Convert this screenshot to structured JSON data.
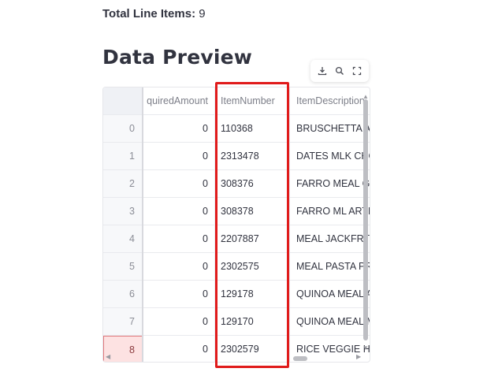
{
  "summary": {
    "label": "Total Line Items:",
    "value": "9"
  },
  "section": {
    "title": "Data Preview"
  },
  "toolbar": {
    "download_icon": "download-icon",
    "search_icon": "search-icon",
    "fullscreen_icon": "fullscreen-icon"
  },
  "table": {
    "columns": {
      "req": "quiredAmount",
      "item": "ItemNumber",
      "desc": "ItemDescription"
    },
    "rows": [
      {
        "idx": "0",
        "req": "0",
        "item": "110368",
        "desc": "BRUSCHETTA A"
      },
      {
        "idx": "1",
        "req": "0",
        "item": "2313478",
        "desc": "DATES MLK CHO"
      },
      {
        "idx": "2",
        "req": "0",
        "item": "308376",
        "desc": "FARRO MEAL GI"
      },
      {
        "idx": "3",
        "req": "0",
        "item": "308378",
        "desc": "FARRO ML ARTH"
      },
      {
        "idx": "4",
        "req": "0",
        "item": "2207887",
        "desc": "MEAL JACKFRT"
      },
      {
        "idx": "5",
        "req": "0",
        "item": "2302575",
        "desc": "MEAL PASTA PR"
      },
      {
        "idx": "6",
        "req": "0",
        "item": "129178",
        "desc": "QUINOA MEAL A"
      },
      {
        "idx": "7",
        "req": "0",
        "item": "129170",
        "desc": "QUINOA MEAL M"
      },
      {
        "idx": "8",
        "req": "0",
        "item": "2302579",
        "desc": "RICE VEGGIE HC"
      }
    ]
  },
  "colors": {
    "highlight": "#e01b1b",
    "text": "#31333f",
    "selected_index_bg": "#fde2e2"
  }
}
